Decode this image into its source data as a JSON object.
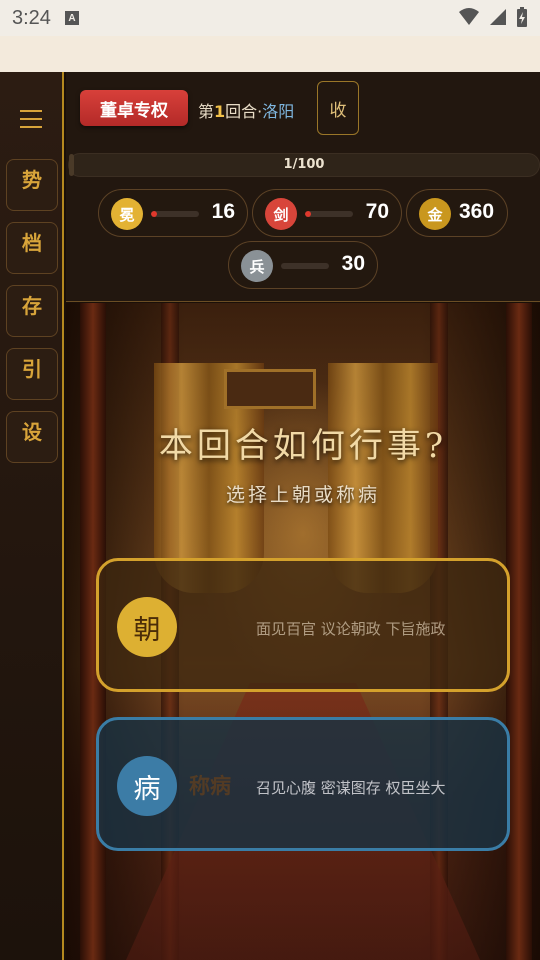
{
  "status_bar": {
    "time": "3:24",
    "notification_icon": "A"
  },
  "sidebar": {
    "menu_icon": "menu-icon",
    "items": [
      {
        "label": "势"
      },
      {
        "label": "档"
      },
      {
        "label": "存"
      },
      {
        "label": "引"
      },
      {
        "label": "设"
      }
    ]
  },
  "header": {
    "faction": "董卓专权",
    "round_prefix": "第",
    "round_number": "1",
    "round_suffix": "回合",
    "separator": "·",
    "city": "洛阳",
    "collapse_label": "收",
    "progress": {
      "text": "1/100",
      "fraction": 0.01
    }
  },
  "stats": [
    {
      "icon_label": "冕",
      "value": "16",
      "level": 0.02,
      "color": "#e3b233"
    },
    {
      "icon_label": "剑",
      "value": "70",
      "level": 0.07,
      "color": "#d8453a"
    },
    {
      "icon_label": "金",
      "value": "360",
      "color": "#c9971e"
    },
    {
      "icon_label": "兵",
      "value": "30",
      "level": 0.0,
      "color": "#8a9196"
    }
  ],
  "scene": {
    "title": "本回合如何行事?",
    "subtitle": "选择上朝或称病"
  },
  "choices": [
    {
      "icon_label": "朝",
      "name": "",
      "desc": "面见百官 议论朝政 下旨施政"
    },
    {
      "icon_label": "病",
      "name": "称病",
      "desc": "召见心腹 密谋图存 权臣坐大"
    }
  ],
  "colors": {
    "gold": "#d8a43a",
    "red_badge": "#c8352f",
    "blue_accent": "#3a7da6"
  }
}
